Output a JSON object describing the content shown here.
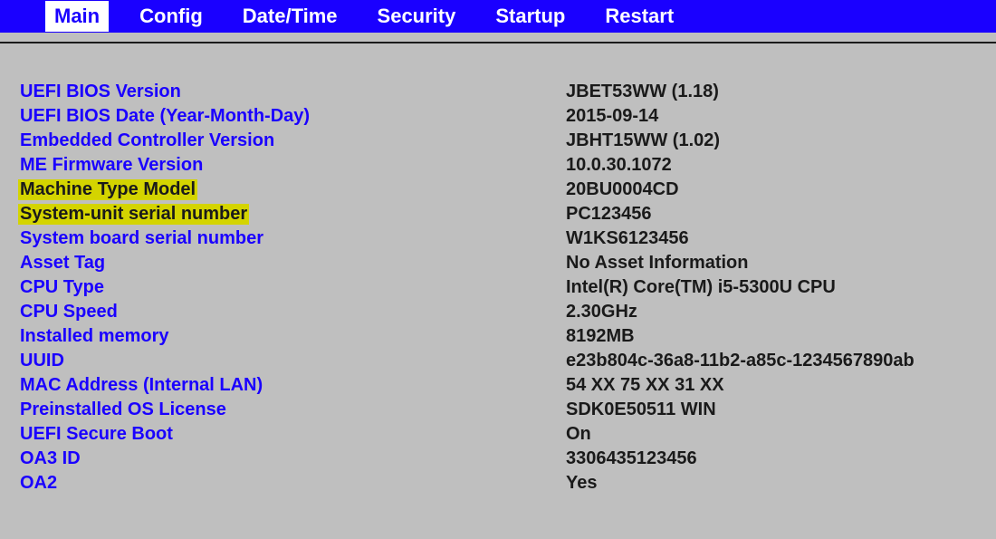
{
  "tabs": {
    "main": "Main",
    "config": "Config",
    "datetime": "Date/Time",
    "security": "Security",
    "startup": "Startup",
    "restart": "Restart"
  },
  "rows": [
    {
      "label": "UEFI BIOS Version",
      "value": "JBET53WW (1.18)",
      "highlight": false
    },
    {
      "label": "UEFI BIOS Date (Year-Month-Day)",
      "value": "2015-09-14",
      "highlight": false
    },
    {
      "label": "Embedded Controller Version",
      "value": "JBHT15WW (1.02)",
      "highlight": false
    },
    {
      "label": "ME Firmware Version",
      "value": "10.0.30.1072",
      "highlight": false
    },
    {
      "label": "Machine Type Model",
      "value": "20BU0004CD",
      "highlight": true
    },
    {
      "label": "System-unit serial number",
      "value": "PC123456",
      "highlight": true
    },
    {
      "label": "System board serial number",
      "value": "W1KS6123456",
      "highlight": false
    },
    {
      "label": "Asset Tag",
      "value": "No Asset Information",
      "highlight": false
    },
    {
      "label": "CPU Type",
      "value": "Intel(R) Core(TM) i5-5300U CPU",
      "highlight": false
    },
    {
      "label": "CPU Speed",
      "value": "2.30GHz",
      "highlight": false
    },
    {
      "label": "Installed memory",
      "value": "8192MB",
      "highlight": false
    },
    {
      "label": "UUID",
      "value": "e23b804c-36a8-11b2-a85c-1234567890ab",
      "highlight": false
    },
    {
      "label": "MAC Address (Internal LAN)",
      "value": "54 XX 75 XX 31 XX",
      "highlight": false
    },
    {
      "label": "Preinstalled OS License",
      "value": "SDK0E50511 WIN",
      "highlight": false
    },
    {
      "label": "UEFI Secure Boot",
      "value": "On",
      "highlight": false
    },
    {
      "label": "OA3 ID",
      "value": "3306435123456",
      "highlight": false
    },
    {
      "label": "OA2",
      "value": "Yes",
      "highlight": false
    }
  ]
}
